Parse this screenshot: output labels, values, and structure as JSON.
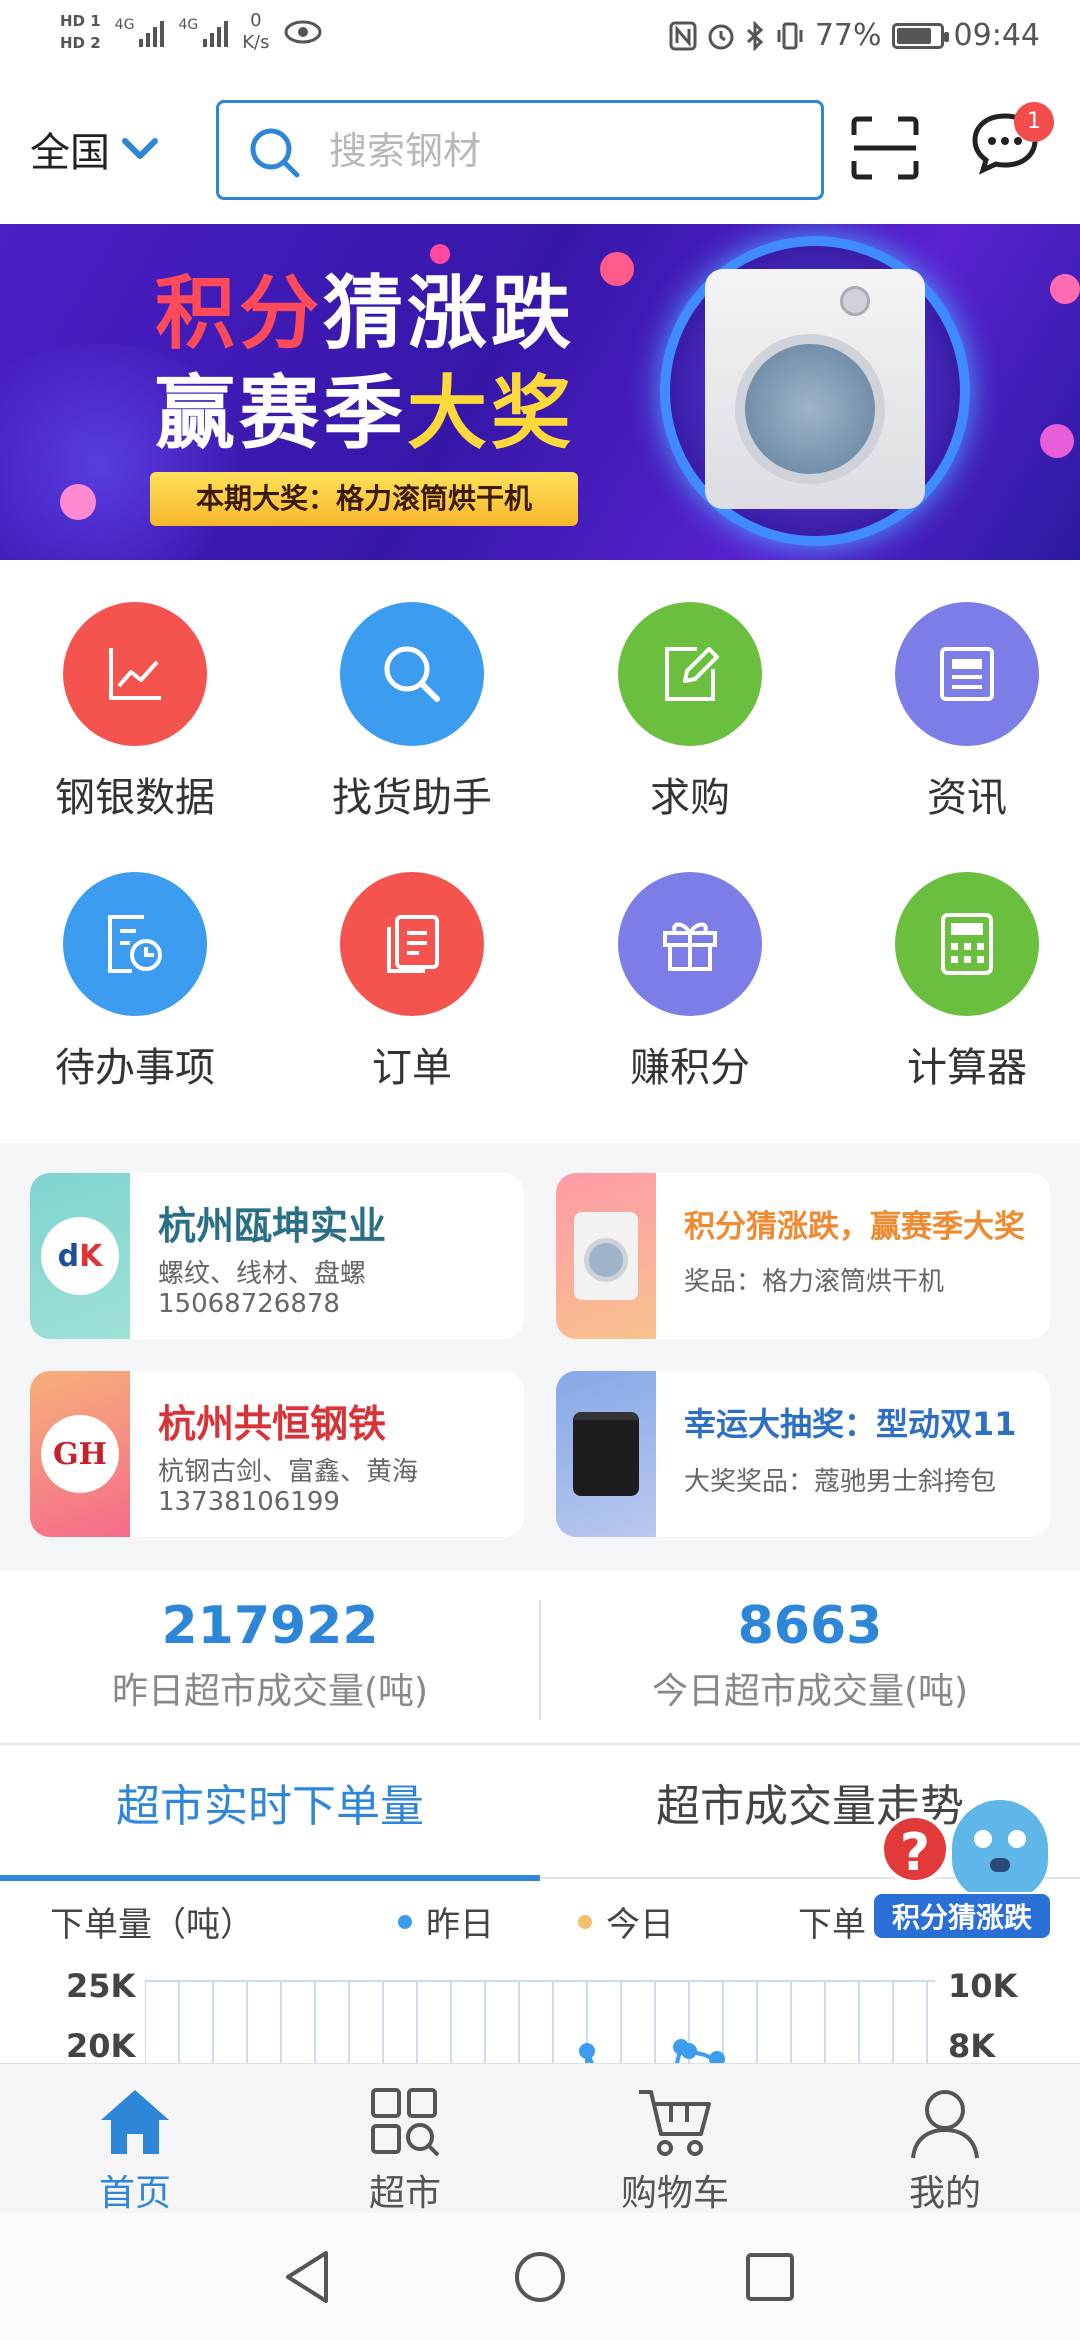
{
  "status_bar": {
    "hd1": "HD 1",
    "hd2": "HD 2",
    "network1": "4G",
    "network2": "4G",
    "speed_value": "0",
    "speed_unit": "K/s",
    "battery": "77%",
    "time": "09:44"
  },
  "header": {
    "region": "全国",
    "search_placeholder": "搜索钢材",
    "message_badge": "1"
  },
  "banner": {
    "title_red": "积分",
    "title_rest": "猜涨跌",
    "line2_white": "赢赛季",
    "line2_yellow": "大奖",
    "strip": "本期大奖：格力滚筒烘干机"
  },
  "grid": {
    "items": [
      {
        "label": "钢银数据",
        "icon": "chart-icon",
        "color": "#f4534e"
      },
      {
        "label": "找货助手",
        "icon": "search-icon",
        "color": "#3c9cf0"
      },
      {
        "label": "求购",
        "icon": "edit-icon",
        "color": "#6bbf3f"
      },
      {
        "label": "资讯",
        "icon": "news-icon",
        "color": "#7d7de8"
      },
      {
        "label": "待办事项",
        "icon": "todo-icon",
        "color": "#3c9cf0"
      },
      {
        "label": "订单",
        "icon": "order-icon",
        "color": "#f4534e"
      },
      {
        "label": "赚积分",
        "icon": "gift-icon",
        "color": "#7d7de8"
      },
      {
        "label": "计算器",
        "icon": "calculator-icon",
        "color": "#6bbf3f"
      }
    ]
  },
  "cards": [
    {
      "title": "杭州瓯坤实业",
      "title_color": "#2a6f86",
      "line1": "螺纹、线材、盘螺",
      "line2": "15068726878",
      "logo": "dK"
    },
    {
      "title": "积分猜涨跌，赢赛季大奖",
      "title_color": "#f08a30",
      "line1": "奖品：格力滚筒烘干机",
      "line2": ""
    },
    {
      "title": "杭州共恒钢铁",
      "title_color": "#d9333a",
      "line1": "杭钢古剑、富鑫、黄海",
      "line2": "13738106199",
      "logo": "GH"
    },
    {
      "title": "幸运大抽奖：型动双11",
      "title_color": "#2d6fc4",
      "line1": "大奖奖品：蔻驰男士斜挎包",
      "line2": ""
    }
  ],
  "stats": [
    {
      "value": "217922",
      "caption": "昨日超市成交量(吨)"
    },
    {
      "value": "8663",
      "caption": "今日超市成交量(吨)"
    }
  ],
  "tabs": [
    {
      "label": "超市实时下单量",
      "active": true
    },
    {
      "label": "超市成交量走势",
      "active": false
    }
  ],
  "chart": {
    "left_axis_label": "下单量（吨）",
    "right_axis_label": "下单",
    "legend_yesterday": "昨日",
    "legend_today": "今日",
    "yesterday_color": "#3c9cf0",
    "today_color": "#f5c06b",
    "left_tick_1": "25K",
    "left_tick_2": "20K",
    "right_tick_1": "10K",
    "right_tick_2": "8K"
  },
  "float_promo": {
    "label": "积分猜涨跌",
    "question": "?"
  },
  "bottom_nav": [
    {
      "label": "首页",
      "icon": "home-icon",
      "active": true
    },
    {
      "label": "超市",
      "icon": "market-icon",
      "active": false
    },
    {
      "label": "购物车",
      "icon": "cart-icon",
      "active": false
    },
    {
      "label": "我的",
      "icon": "profile-icon",
      "active": false
    }
  ]
}
